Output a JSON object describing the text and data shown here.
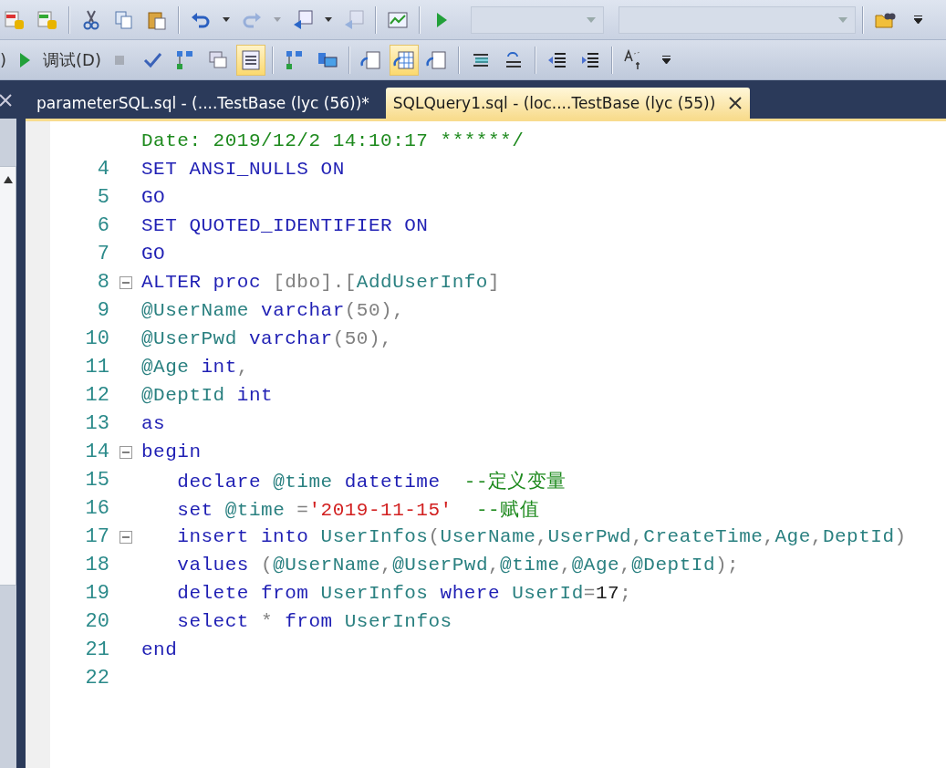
{
  "toolbar_top": [
    {
      "kind": "db"
    },
    {
      "kind": "db2"
    },
    {
      "kind": "sep"
    },
    {
      "kind": "cut"
    },
    {
      "kind": "copy"
    },
    {
      "kind": "paste"
    },
    {
      "kind": "sep"
    },
    {
      "kind": "undo"
    },
    {
      "kind": "drop"
    },
    {
      "kind": "redo",
      "disabled": true
    },
    {
      "kind": "drop",
      "disabled": true
    },
    {
      "kind": "nav"
    },
    {
      "kind": "drop"
    },
    {
      "kind": "nav",
      "disabled": true
    },
    {
      "kind": "sep"
    },
    {
      "kind": "chart"
    },
    {
      "kind": "sep"
    },
    {
      "kind": "play"
    },
    {
      "kind": "combo"
    },
    {
      "kind": "combo",
      "wide": true
    },
    {
      "kind": "sep"
    },
    {
      "kind": "folder"
    },
    {
      "kind": "more"
    }
  ],
  "toolbar_second": [
    {
      "kind": "text",
      "label": ")"
    },
    {
      "kind": "play"
    },
    {
      "kind": "text",
      "label": "调试(D)"
    },
    {
      "kind": "stop",
      "disabled": true
    },
    {
      "kind": "check"
    },
    {
      "kind": "tree",
      "selected": false
    },
    {
      "kind": "windows",
      "selected": false
    },
    {
      "kind": "list",
      "selected": true
    },
    {
      "kind": "sep"
    },
    {
      "kind": "tree",
      "selected": false
    },
    {
      "kind": "computer",
      "selected": false
    },
    {
      "kind": "sep"
    },
    {
      "kind": "doc",
      "selected": false
    },
    {
      "kind": "grid",
      "selected": true
    },
    {
      "kind": "doc",
      "selected": false
    },
    {
      "kind": "sep"
    },
    {
      "kind": "lines",
      "selected": false
    },
    {
      "kind": "uncomment",
      "selected": false
    },
    {
      "kind": "sep"
    },
    {
      "kind": "outdent",
      "selected": false
    },
    {
      "kind": "indent",
      "selected": false
    },
    {
      "kind": "sep"
    },
    {
      "kind": "replace",
      "selected": false
    },
    {
      "kind": "more"
    }
  ],
  "tabs": [
    {
      "label": "parameterSQL.sql - (....TestBase (lyc (56))*",
      "selected": false
    },
    {
      "label": "SQLQuery1.sql - (loc....TestBase (lyc (55))",
      "selected": true,
      "closable": true
    }
  ],
  "editor": {
    "lines": [
      {
        "tokens": [
          {
            "kind": "comment",
            "text": "Date: 2019/12/2 14:10:17 ******/"
          }
        ]
      },
      {
        "number": "4",
        "tokens": [
          {
            "kind": "keyword",
            "text": "SET ANSI_NULLS ON"
          }
        ]
      },
      {
        "number": "5",
        "tokens": [
          {
            "kind": "keyword",
            "text": "GO"
          }
        ]
      },
      {
        "number": "6",
        "tokens": [
          {
            "kind": "keyword",
            "text": "SET QUOTED_IDENTIFIER ON"
          }
        ]
      },
      {
        "number": "7",
        "tokens": [
          {
            "kind": "keyword",
            "text": "GO"
          }
        ]
      },
      {
        "number": "8",
        "fold": true,
        "tokens": [
          {
            "kind": "keyword",
            "text": "ALTER proc "
          },
          {
            "kind": "punct",
            "text": "[dbo].["
          },
          {
            "kind": "ident",
            "text": "AddUserInfo"
          },
          {
            "kind": "punct",
            "text": "]"
          }
        ]
      },
      {
        "number": "9",
        "tokens": [
          {
            "kind": "ident",
            "text": "@UserName "
          },
          {
            "kind": "keyword",
            "text": "varchar"
          },
          {
            "kind": "punct",
            "text": "(50),"
          }
        ]
      },
      {
        "number": "10",
        "tokens": [
          {
            "kind": "ident",
            "text": "@UserPwd "
          },
          {
            "kind": "keyword",
            "text": "varchar"
          },
          {
            "kind": "punct",
            "text": "(50),"
          }
        ]
      },
      {
        "number": "11",
        "tokens": [
          {
            "kind": "ident",
            "text": "@Age "
          },
          {
            "kind": "keyword",
            "text": "int"
          },
          {
            "kind": "punct",
            "text": ","
          }
        ]
      },
      {
        "number": "12",
        "tokens": [
          {
            "kind": "ident",
            "text": "@DeptId "
          },
          {
            "kind": "keyword",
            "text": "int"
          }
        ]
      },
      {
        "number": "13",
        "tokens": [
          {
            "kind": "keyword",
            "text": "as"
          }
        ]
      },
      {
        "number": "14",
        "fold": true,
        "tokens": [
          {
            "kind": "keyword",
            "text": "begin"
          }
        ]
      },
      {
        "number": "15",
        "tokens": [
          {
            "kind": "keyword",
            "text": "   declare "
          },
          {
            "kind": "ident",
            "text": "@time "
          },
          {
            "kind": "keyword",
            "text": "datetime  "
          },
          {
            "kind": "comment",
            "text": "--定义变量"
          }
        ]
      },
      {
        "number": "16",
        "tokens": [
          {
            "kind": "keyword",
            "text": "   set "
          },
          {
            "kind": "ident",
            "text": "@time "
          },
          {
            "kind": "punct",
            "text": "="
          },
          {
            "kind": "string",
            "text": "'2019-11-15'"
          },
          {
            "kind": "comment",
            "text": "  --赋值"
          }
        ]
      },
      {
        "number": "17",
        "fold": true,
        "tokens": [
          {
            "kind": "keyword",
            "text": "   insert into "
          },
          {
            "kind": "ident",
            "text": "UserInfos"
          },
          {
            "kind": "punct",
            "text": "("
          },
          {
            "kind": "ident",
            "text": "UserName"
          },
          {
            "kind": "punct",
            "text": ","
          },
          {
            "kind": "ident",
            "text": "UserPwd"
          },
          {
            "kind": "punct",
            "text": ","
          },
          {
            "kind": "ident",
            "text": "CreateTime"
          },
          {
            "kind": "punct",
            "text": ","
          },
          {
            "kind": "ident",
            "text": "Age"
          },
          {
            "kind": "punct",
            "text": ","
          },
          {
            "kind": "ident",
            "text": "DeptId"
          },
          {
            "kind": "punct",
            "text": ")"
          }
        ]
      },
      {
        "number": "18",
        "tokens": [
          {
            "kind": "keyword",
            "text": "   values "
          },
          {
            "kind": "punct",
            "text": "("
          },
          {
            "kind": "ident",
            "text": "@UserName"
          },
          {
            "kind": "punct",
            "text": ","
          },
          {
            "kind": "ident",
            "text": "@UserPwd"
          },
          {
            "kind": "punct",
            "text": ","
          },
          {
            "kind": "ident",
            "text": "@time"
          },
          {
            "kind": "punct",
            "text": ","
          },
          {
            "kind": "ident",
            "text": "@Age"
          },
          {
            "kind": "punct",
            "text": ","
          },
          {
            "kind": "ident",
            "text": "@DeptId"
          },
          {
            "kind": "punct",
            "text": ");"
          }
        ]
      },
      {
        "number": "19",
        "tokens": [
          {
            "kind": "keyword",
            "text": "   delete from "
          },
          {
            "kind": "ident",
            "text": "UserInfos "
          },
          {
            "kind": "keyword",
            "text": "where "
          },
          {
            "kind": "ident",
            "text": "UserId"
          },
          {
            "kind": "punct",
            "text": "="
          },
          {
            "kind": "plain",
            "text": "17"
          },
          {
            "kind": "punct",
            "text": ";"
          }
        ]
      },
      {
        "number": "20",
        "tokens": [
          {
            "kind": "keyword",
            "text": "   select "
          },
          {
            "kind": "punct",
            "text": "* "
          },
          {
            "kind": "keyword",
            "text": "from "
          },
          {
            "kind": "ident",
            "text": "UserInfos"
          }
        ]
      },
      {
        "number": "21",
        "tokens": [
          {
            "kind": "keyword",
            "text": "end"
          }
        ]
      },
      {
        "number": "22"
      }
    ]
  }
}
